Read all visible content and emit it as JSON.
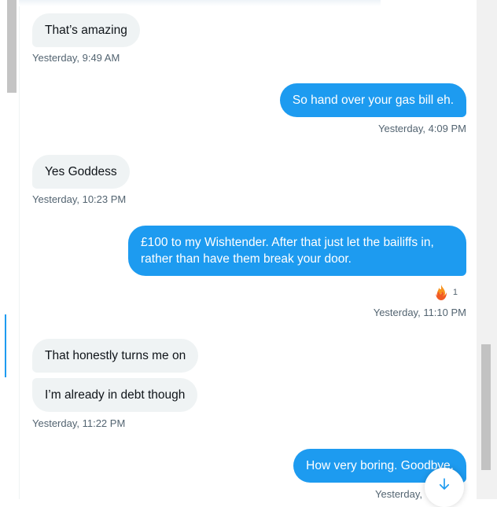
{
  "conversation": {
    "messages": [
      {
        "id": "m1",
        "direction": "in",
        "text": "That’s amazing"
      },
      {
        "id": "m2",
        "direction": "out",
        "text": "So hand over your gas bill eh."
      },
      {
        "id": "m3",
        "direction": "in",
        "text": "Yes Goddess"
      },
      {
        "id": "m4",
        "direction": "out",
        "text": "£100 to my Wishtender. After that just let the bailiffs in, rather than have them break your door."
      },
      {
        "id": "m5",
        "direction": "in",
        "text": "That honestly turns me on"
      },
      {
        "id": "m6",
        "direction": "in",
        "text": "I’m already in debt though"
      },
      {
        "id": "m7",
        "direction": "out",
        "text": "How very boring. Goodbye."
      }
    ],
    "timestamps": {
      "t1": "Yesterday, 9:49 AM",
      "t2": "Yesterday, 4:09 PM",
      "t3": "Yesterday, 10:23 PM",
      "t4": "Yesterday, 11:10 PM",
      "t5": "Yesterday, 11:22 PM",
      "t6": "Yesterday,"
    },
    "reaction": {
      "emoji": "fire-icon",
      "count": "1"
    }
  },
  "colors": {
    "accent": "#1d9bf0",
    "incoming_bubble": "#eff3f4",
    "timestamp": "#536471"
  },
  "controls": {
    "scroll_down_icon": "arrow-down-icon"
  }
}
